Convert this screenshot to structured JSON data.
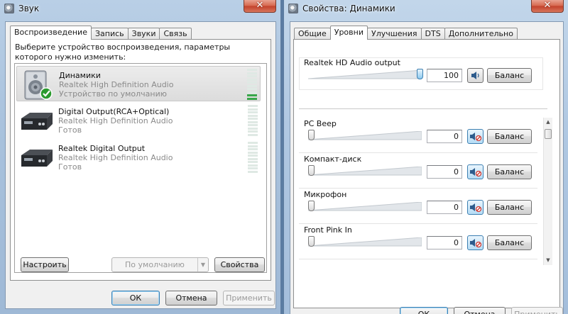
{
  "sound_window": {
    "title": "Звук",
    "close": "✕",
    "tabs": [
      "Воспроизведение",
      "Запись",
      "Звуки",
      "Связь"
    ],
    "instruction": "Выберите устройство воспроизведения, параметры которого нужно изменить:",
    "devices": [
      {
        "name": "Динамики",
        "subtitle": "Realtek High Definition Audio",
        "status": "Устройство по умолчанию",
        "selected": true,
        "icon": "speakers-icon",
        "default": true,
        "meter_level": 0.15
      },
      {
        "name": "Digital Output(RCA+Optical)",
        "subtitle": "Realtek High Definition Audio",
        "status": "Готов",
        "selected": false,
        "icon": "digital-output-icon",
        "meter_level": 0
      },
      {
        "name": "Realtek Digital Output",
        "subtitle": "Realtek High Definition Audio",
        "status": "Готов",
        "selected": false,
        "icon": "digital-output-icon",
        "meter_level": 0
      }
    ],
    "configure_label": "Настроить",
    "set_default_label": "По умолчанию",
    "set_default_arrow": "▼",
    "properties_label": "Свойства",
    "ok_label": "ОК",
    "cancel_label": "Отмена",
    "apply_label": "Применить"
  },
  "props_window": {
    "title": "Свойства: Динамики",
    "close": "✕",
    "tabs": [
      "Общие",
      "Уровни",
      "Улучшения",
      "DTS",
      "Дополнительно"
    ],
    "active_tab": 1,
    "master": {
      "label": "Realtek HD Audio output",
      "value": "100",
      "level": 1.0,
      "muted": false,
      "balance_label": "Баланс"
    },
    "channels": [
      {
        "label": "PC Beep",
        "value": "0",
        "level": 0,
        "muted": true,
        "balance_label": "Баланс"
      },
      {
        "label": "Компакт-диск",
        "value": "0",
        "level": 0,
        "muted": true,
        "balance_label": "Баланс"
      },
      {
        "label": "Микрофон",
        "value": "0",
        "level": 0,
        "muted": true,
        "balance_label": "Баланс"
      },
      {
        "label": "Front Pink In",
        "value": "0",
        "level": 0,
        "muted": true,
        "balance_label": "Баланс"
      }
    ],
    "scroll_up": "▲",
    "scroll_down": "▼",
    "ok_label": "ОК",
    "cancel_label": "Отмена",
    "apply_label": "Применить"
  },
  "colors": {
    "aero_frame": "#a9c2dd",
    "close_red": "#c2412a",
    "meter_green": "#38a64a",
    "check_green": "#2a9a2e",
    "mute_blue": "#3c7fb1"
  }
}
